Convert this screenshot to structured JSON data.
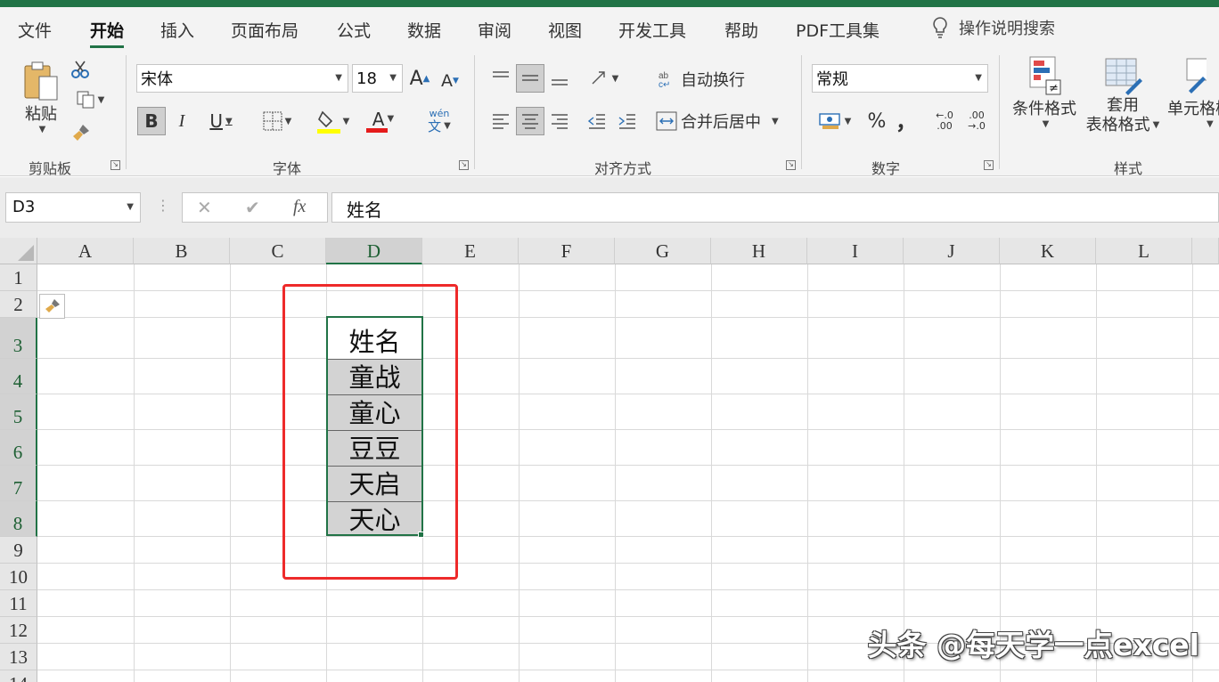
{
  "ribbon_tabs": [
    "文件",
    "开始",
    "插入",
    "页面布局",
    "公式",
    "数据",
    "审阅",
    "视图",
    "开发工具",
    "帮助",
    "PDF工具集"
  ],
  "active_tab": "开始",
  "tell_me": "操作说明搜索",
  "clipboard": {
    "paste_label": "粘贴",
    "group_label": "剪贴板"
  },
  "font": {
    "name": "宋体",
    "size": "18",
    "group_label": "字体",
    "bold": "B",
    "italic": "I",
    "underline": "U",
    "font_color_glyph": "A",
    "phonetic_top": "wén",
    "phonetic_bottom": "文",
    "grow_glyph": "A",
    "shrink_glyph": "A"
  },
  "alignment": {
    "wrap_text": "自动换行",
    "merge_center": "合并后居中",
    "group_label": "对齐方式"
  },
  "number": {
    "format": "常规",
    "percent": "%",
    "comma": "，",
    "inc_decimal_top": "←.0",
    "inc_decimal_bottom": ".00",
    "dec_decimal_top": ".00",
    "dec_decimal_bottom": "→.0",
    "group_label": "数字"
  },
  "styles": {
    "conditional_format": "条件格式",
    "format_table_1": "套用",
    "format_table_2": "表格格式",
    "cell_styles": "单元格样",
    "group_label": "样式"
  },
  "formula_bar": {
    "name_box": "D3",
    "fx": "fx",
    "content": "姓名"
  },
  "columns": [
    "A",
    "B",
    "C",
    "D",
    "E",
    "F",
    "G",
    "H",
    "I",
    "J",
    "K",
    "L"
  ],
  "rows": [
    "1",
    "2",
    "3",
    "4",
    "5",
    "6",
    "7",
    "8",
    "9",
    "10",
    "11",
    "12",
    "13",
    "14"
  ],
  "selected_cell": "D3",
  "cells": {
    "D3": "姓名",
    "D4": "童战",
    "D5": "童心",
    "D6": "豆豆",
    "D7": "天启",
    "D8": "天心"
  },
  "watermark": "头条 @每天学一点excel",
  "colors": {
    "accent": "#217346",
    "highlight": "#ee2a2a",
    "fill_gray": "#d3d3d3"
  }
}
